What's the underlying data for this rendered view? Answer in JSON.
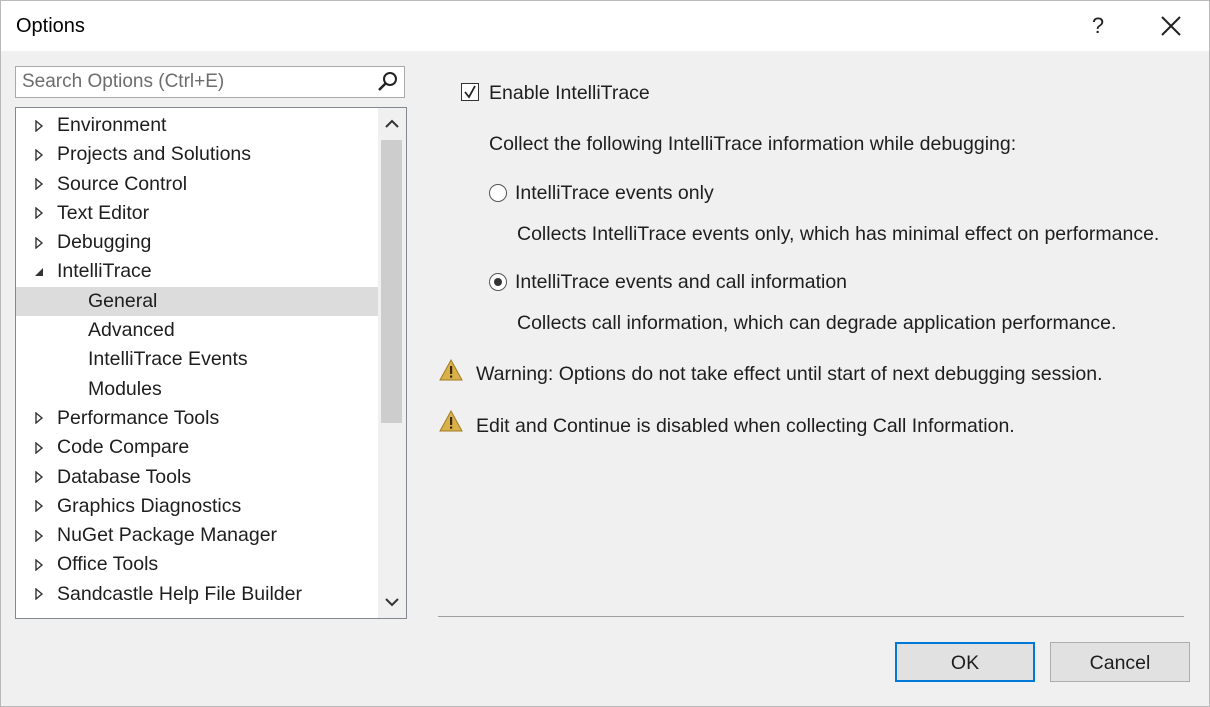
{
  "window": {
    "title": "Options",
    "help_label": "?",
    "close_label": "✕"
  },
  "search": {
    "placeholder": "Search Options (Ctrl+E)",
    "icon": "search-icon"
  },
  "tree": {
    "items": [
      {
        "label": "Environment",
        "level": 0,
        "state": "collapsed"
      },
      {
        "label": "Projects and Solutions",
        "level": 0,
        "state": "collapsed"
      },
      {
        "label": "Source Control",
        "level": 0,
        "state": "collapsed"
      },
      {
        "label": "Text Editor",
        "level": 0,
        "state": "collapsed"
      },
      {
        "label": "Debugging",
        "level": 0,
        "state": "collapsed"
      },
      {
        "label": "IntelliTrace",
        "level": 0,
        "state": "expanded"
      },
      {
        "label": "General",
        "level": 1,
        "state": "leaf",
        "selected": true
      },
      {
        "label": "Advanced",
        "level": 1,
        "state": "leaf"
      },
      {
        "label": "IntelliTrace Events",
        "level": 1,
        "state": "leaf"
      },
      {
        "label": "Modules",
        "level": 1,
        "state": "leaf"
      },
      {
        "label": "Performance Tools",
        "level": 0,
        "state": "collapsed"
      },
      {
        "label": "Code Compare",
        "level": 0,
        "state": "collapsed"
      },
      {
        "label": "Database Tools",
        "level": 0,
        "state": "collapsed"
      },
      {
        "label": "Graphics Diagnostics",
        "level": 0,
        "state": "collapsed"
      },
      {
        "label": "NuGet Package Manager",
        "level": 0,
        "state": "collapsed"
      },
      {
        "label": "Office Tools",
        "level": 0,
        "state": "collapsed"
      },
      {
        "label": "Sandcastle Help File Builder",
        "level": 0,
        "state": "collapsed"
      }
    ]
  },
  "settings": {
    "enable_label": "Enable IntelliTrace",
    "enable_checked": true,
    "collect_heading": "Collect the following IntelliTrace information while debugging:",
    "option_events_label": "IntelliTrace events only",
    "option_events_desc": "Collects IntelliTrace events only, which has minimal effect on performance.",
    "option_events_selected": false,
    "option_calls_label": "IntelliTrace events and call information",
    "option_calls_desc": "Collects call information, which can degrade application performance.",
    "option_calls_selected": true,
    "warning_1": "Warning: Options do not take effect until start of next debugging session.",
    "warning_2": "Edit and Continue is disabled when collecting Call Information."
  },
  "buttons": {
    "ok_label": "OK",
    "cancel_label": "Cancel"
  },
  "colors": {
    "accent": "#0078d7",
    "selected_row": "#dcdcdc",
    "warning": "#c9a02a"
  }
}
